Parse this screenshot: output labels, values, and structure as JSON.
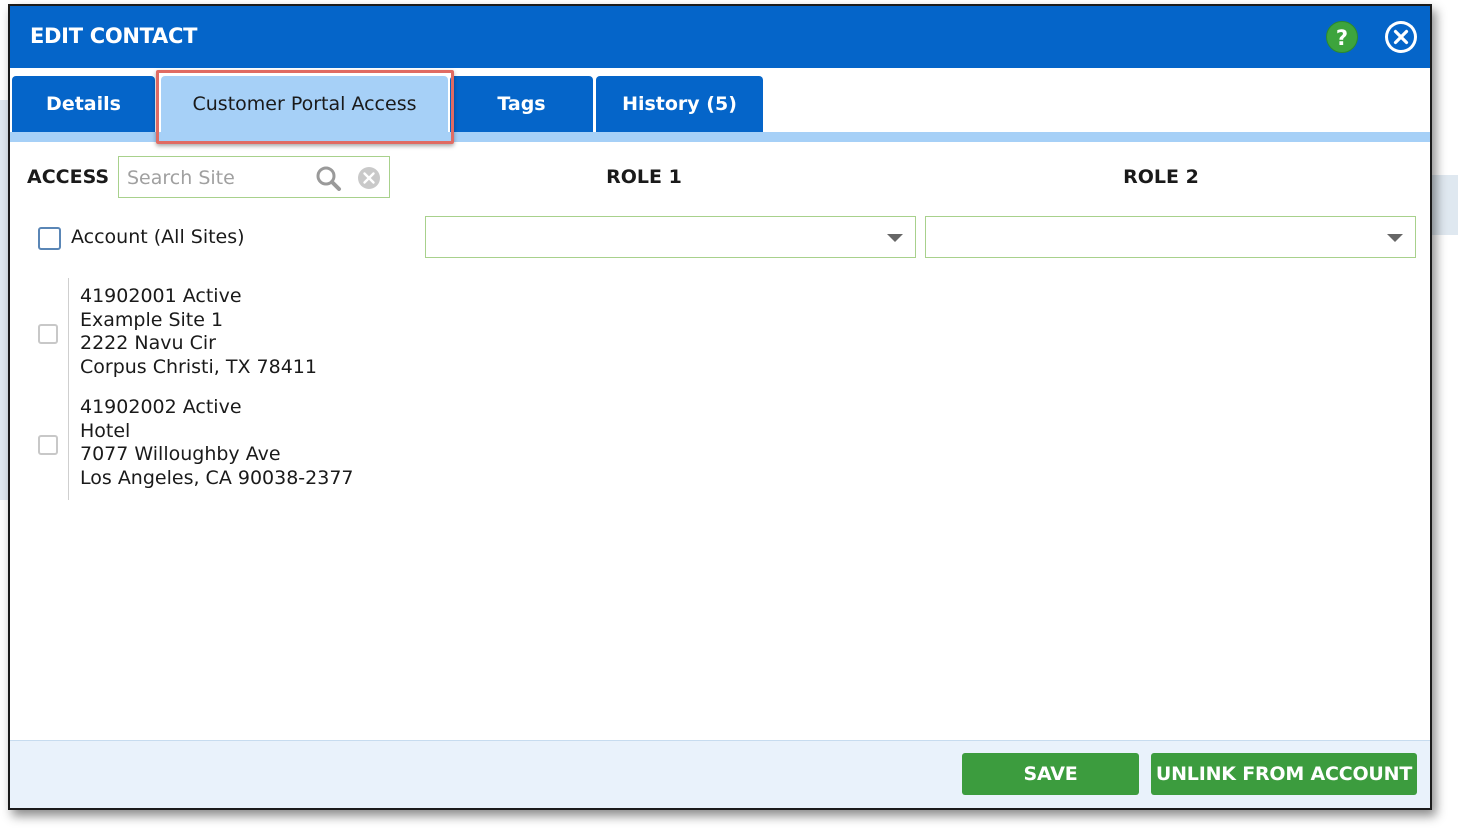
{
  "dialog": {
    "title": "EDIT CONTACT",
    "help_glyph": "?"
  },
  "tabs": [
    {
      "label": "Details"
    },
    {
      "label": "Customer Portal Access",
      "active": true
    },
    {
      "label": "Tags"
    },
    {
      "label": "History (5)"
    }
  ],
  "access": {
    "label": "ACCESS",
    "search": {
      "placeholder": "Search Site",
      "value": ""
    },
    "role1_header": "ROLE 1",
    "role2_header": "ROLE 2",
    "account_row": {
      "label": "Account (All Sites)",
      "checked": false,
      "role1": "",
      "role2": ""
    },
    "sites": [
      {
        "line1": "41902001 Active",
        "line2": "Example Site 1",
        "line3": "2222 Navu Cir",
        "line4": "Corpus Christi, TX 78411",
        "checked": false
      },
      {
        "line1": "41902002 Active",
        "line2": "Hotel",
        "line3": "7077 Willoughby Ave",
        "line4": "Los Angeles, CA 90038-2377",
        "checked": false
      }
    ]
  },
  "footer": {
    "save_label": "SAVE",
    "unlink_label": "UNLINK FROM ACCOUNT"
  },
  "colors": {
    "header_blue": "#0565c9",
    "active_tab": "#a6d0f7",
    "highlight": "#e06b63",
    "button_green": "#3c9c3e"
  },
  "icons": [
    "help-icon",
    "close-icon",
    "search-icon",
    "clear-icon",
    "chevron-down-icon"
  ]
}
